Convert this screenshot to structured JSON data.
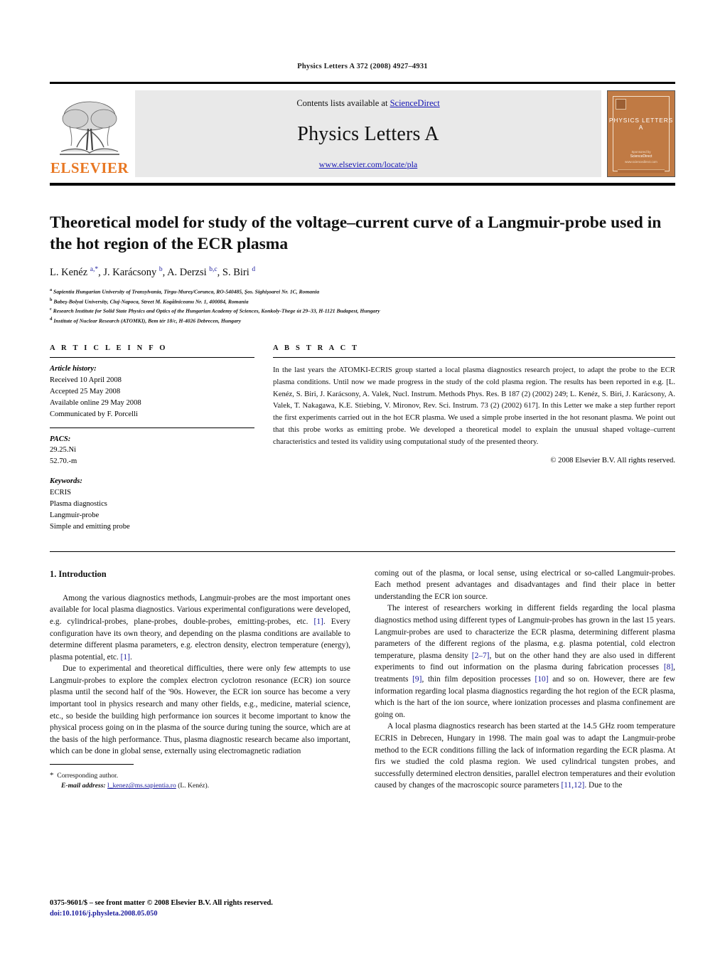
{
  "running_head": "Physics Letters A 372 (2008) 4927–4931",
  "masthead": {
    "publisher": "ELSEVIER",
    "contents_prefix": "Contents lists available at",
    "contents_link": "ScienceDirect",
    "journal_name": "Physics Letters A",
    "journal_url": "www.elsevier.com/locate/pla",
    "cover_title": "PHYSICS LETTERS A",
    "cover_foot_line1": "Sponsored by",
    "cover_foot_line2": "ScienceDirect",
    "cover_foot_line3": "www.sciencedirect.com"
  },
  "article": {
    "title": "Theoretical model for study of the voltage–current curve of a Langmuir-probe used in the hot region of the ECR plasma",
    "authors_html": "L. Kenéz <sup>a,*</sup>, J. Karácsony <sup>b</sup>, A. Derzsi <sup>b,c</sup>, S. Biri <sup>d</sup>",
    "affiliations": [
      {
        "mark": "a",
        "text": "Sapientia Hungarian University of Transylvania, Tîrgu-Mureş/Corunca, RO-540485, Şos. Sighişoarei Nr. 1C, Romania"
      },
      {
        "mark": "b",
        "text": "Babeş-Bolyai University, Cluj-Napoca, Street M. Kogălniceanu Nr. 1, 400084, Romania"
      },
      {
        "mark": "c",
        "text": "Research Institute for Solid State Physics and Optics of the Hungarian Academy of Sciences, Konkoly-Thege út 29–33, H-1121 Budapest, Hungary"
      },
      {
        "mark": "d",
        "text": "Institute of Nuclear Research (ATOMKI), Bem tér 18/c, H-4026 Debrecen, Hungary"
      }
    ]
  },
  "article_info": {
    "heading": "A R T I C L E    I N F O",
    "history_label": "Article history:",
    "history": [
      "Received 10 April 2008",
      "Accepted 25 May 2008",
      "Available online 29 May 2008",
      "Communicated by F. Porcelli"
    ],
    "pacs_label": "PACS:",
    "pacs": [
      "29.25.Ni",
      "52.70.-m"
    ],
    "keywords_label": "Keywords:",
    "keywords": [
      "ECRIS",
      "Plasma diagnostics",
      "Langmuir-probe",
      "Simple and emitting probe"
    ]
  },
  "abstract": {
    "heading": "A B S T R A C T",
    "text": "In the last years the ATOMKI-ECRIS group started a local plasma diagnostics research project, to adapt the probe to the ECR plasma conditions. Until now we made progress in the study of the cold plasma region. The results has been reported in e.g. [L. Kenéz, S. Biri, J. Karácsony, A. Valek, Nucl. Instrum. Methods Phys. Res. B 187 (2) (2002) 249; L. Kenéz, S. Biri, J. Karácsony, A. Valek, T. Nakagawa, K.E. Stiebing, V. Mironov, Rev. Sci. Instrum. 73 (2) (2002) 617]. In this Letter we make a step further report the first experiments carried out in the hot ECR plasma. We used a simple probe inserted in the hot resonant plasma. We point out that this probe works as emitting probe. We developed a theoretical model to explain the unusual shaped voltage–current characteristics and tested its validity using computational study of the presented theory.",
    "copyright": "© 2008 Elsevier B.V. All rights reserved."
  },
  "body": {
    "section_title": "1. Introduction",
    "left_paragraphs": [
      "Among the various diagnostics methods, Langmuir-probes are the most important ones available for local plasma diagnostics. Various experimental configurations were developed, e.g. cylindrical-probes, plane-probes, double-probes, emitting-probes, etc. <span class=\"cite\">[1]</span>. Every configuration have its own theory, and depending on the plasma conditions are available to determine different plasma parameters, e.g. electron density, electron temperature (energy), plasma potential, etc. <span class=\"cite\">[1]</span>.",
      "Due to experimental and theoretical difficulties, there were only few attempts to use Langmuir-probes to explore the complex electron cyclotron resonance (ECR) ion source plasma until the second half of the '90s. However, the ECR ion source has become a very important tool in physics research and many other fields, e.g., medicine, material science, etc., so beside the building high performance ion sources it become important to know the physical process going on in the plasma of the source during tuning the source, which are at the basis of the high performance. Thus, plasma diagnostic research became also important, which can be done in global sense, externally using electromagnetic radiation"
    ],
    "right_paragraphs": [
      "coming out of the plasma, or local sense, using electrical or so-called Langmuir-probes. Each method present advantages and disadvantages and find their place in better understanding the ECR ion source.",
      "The interest of researchers working in different fields regarding the local plasma diagnostics method using different types of Langmuir-probes has grown in the last 15 years. Langmuir-probes are used to characterize the ECR plasma, determining different plasma parameters of the different regions of the plasma, e.g. plasma potential, cold electron temperature, plasma density <span class=\"cite\">[2–7]</span>, but on the other hand they are also used in different experiments to find out information on the plasma during fabrication processes <span class=\"cite\">[8]</span>, treatments <span class=\"cite\">[9]</span>, thin film deposition processes <span class=\"cite\">[10]</span> and so on. However, there are few information regarding local plasma diagnostics regarding the hot region of the ECR plasma, which is the hart of the ion source, where ionization processes and plasma confinement are going on.",
      "A local plasma diagnostics research has been started at the 14.5 GHz room temperature ECRIS in Debrecen, Hungary in 1998. The main goal was to adapt the Langmuir-probe method to the ECR conditions filling the lack of information regarding the ECR plasma. At firs we studied the cold plasma region. We used cylindrical tungsten probes, and successfully determined electron densities, parallel electron temperatures and their evolution caused by changes of the macroscopic source parameters <span class=\"cite\">[11,12]</span>. Due to the"
    ]
  },
  "footnote": {
    "star": "*",
    "corresponding": "Corresponding author.",
    "email_label": "E-mail address:",
    "email": "l_kenez@ms.sapientia.ro",
    "email_owner": "(L. Kenéz)."
  },
  "frontmatter": {
    "line1": "0375-9601/$ – see front matter © 2008 Elsevier B.V. All rights reserved.",
    "doi": "doi:10.1016/j.physleta.2008.05.050"
  },
  "colors": {
    "link": "#1414b4",
    "citation": "#1a1a9c",
    "elsevier_orange": "#E87722",
    "cover_background": "#c07a44",
    "band_background": "#e9e9e9"
  }
}
